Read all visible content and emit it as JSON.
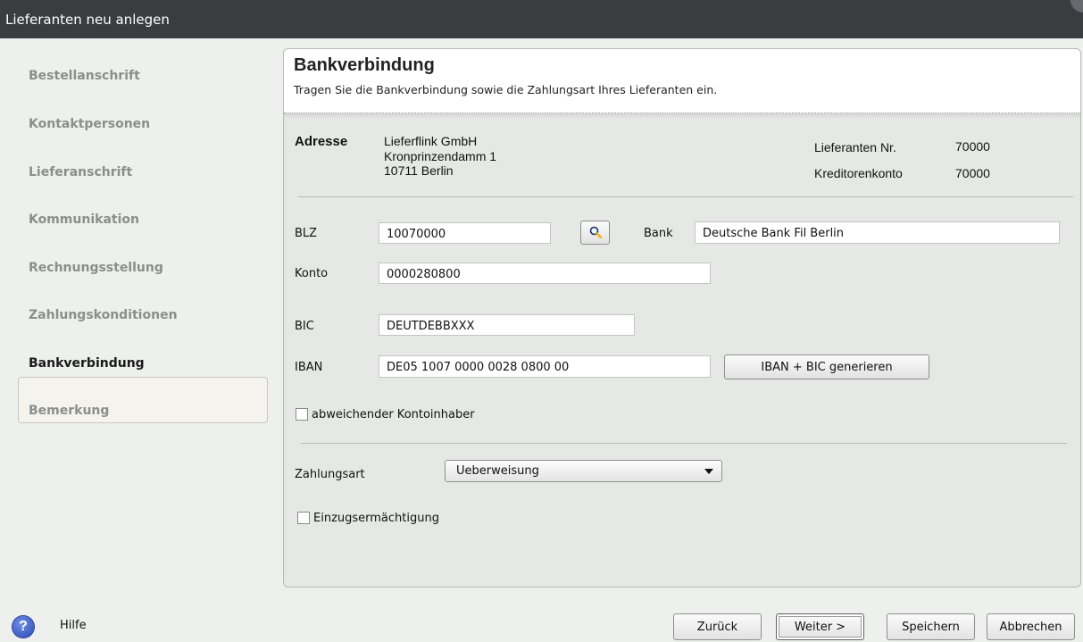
{
  "window": {
    "title": "Lieferanten neu anlegen"
  },
  "sidebar": {
    "items": [
      {
        "label": "Bestellanschrift",
        "active": false
      },
      {
        "label": "Kontaktpersonen",
        "active": false
      },
      {
        "label": "Lieferanschrift",
        "active": false
      },
      {
        "label": "Kommunikation",
        "active": false
      },
      {
        "label": "Rechnungsstellung",
        "active": false
      },
      {
        "label": "Zahlungskonditionen",
        "active": false
      },
      {
        "label": "Bankverbindung",
        "active": true
      },
      {
        "label": "Bemerkung",
        "active": false
      }
    ]
  },
  "header": {
    "title": "Bankverbindung",
    "subtitle": "Tragen Sie die Bankverbindung sowie die Zahlungsart Ihres Lieferanten ein."
  },
  "address": {
    "label": "Adresse",
    "line1": "Lieferflink GmbH",
    "line2": "Kronprinzendamm 1",
    "line3": "10711 Berlin",
    "supplier_no_label": "Lieferanten Nr.",
    "supplier_no": "70000",
    "creditor_label": "Kreditorenkonto",
    "creditor": "70000"
  },
  "form": {
    "blz_label": "BLZ",
    "blz": "10070000",
    "bank_label": "Bank",
    "bank": "Deutsche Bank Fil Berlin",
    "konto_label": "Konto",
    "konto": "0000280800",
    "bic_label": "BIC",
    "bic": "DEUTDEBBXXX",
    "iban_label": "IBAN",
    "iban": "DE05 1007 0000 0028 0800 00",
    "generate_button": "IBAN + BIC generieren",
    "alt_owner_label": "abweichender Kontoinhaber",
    "alt_owner_checked": false,
    "payment_label": "Zahlungsart",
    "payment_value": "Ueberweisung",
    "direct_debit_label": "Einzugsermächtigung",
    "direct_debit_checked": false
  },
  "footer": {
    "help": "Hilfe",
    "back": "Zurück",
    "next": "Weiter >",
    "save": "Speichern",
    "cancel": "Abbrechen"
  },
  "icons": {
    "search": "magnifier-icon",
    "help": "question-icon",
    "dropdown": "chevron-down-icon"
  }
}
